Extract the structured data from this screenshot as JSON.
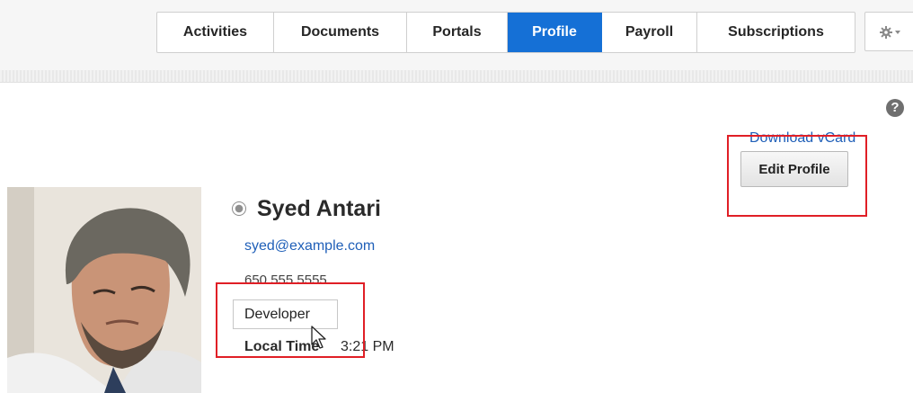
{
  "nav": {
    "tabs": [
      {
        "label": "Activities",
        "active": false
      },
      {
        "label": "Documents",
        "active": false
      },
      {
        "label": "Portals",
        "active": false
      },
      {
        "label": "Profile",
        "active": true
      },
      {
        "label": "Payroll",
        "active": false
      },
      {
        "label": "Subscriptions",
        "active": false
      }
    ],
    "settings_icon": "gear-icon",
    "active_color": "#1570d6"
  },
  "help": {
    "glyph": "?"
  },
  "actions": {
    "download_vcard": "Download vCard",
    "edit_profile": "Edit Profile"
  },
  "profile": {
    "name": "Syed Antari",
    "email": "syed@example.com",
    "phone": "650 555 5555",
    "job_title": "Developer",
    "local_time_label": "Local Time",
    "local_time_value": "3:21 PM",
    "presence_icon": "presence-status-icon"
  },
  "annotation_color": "#e01f26"
}
